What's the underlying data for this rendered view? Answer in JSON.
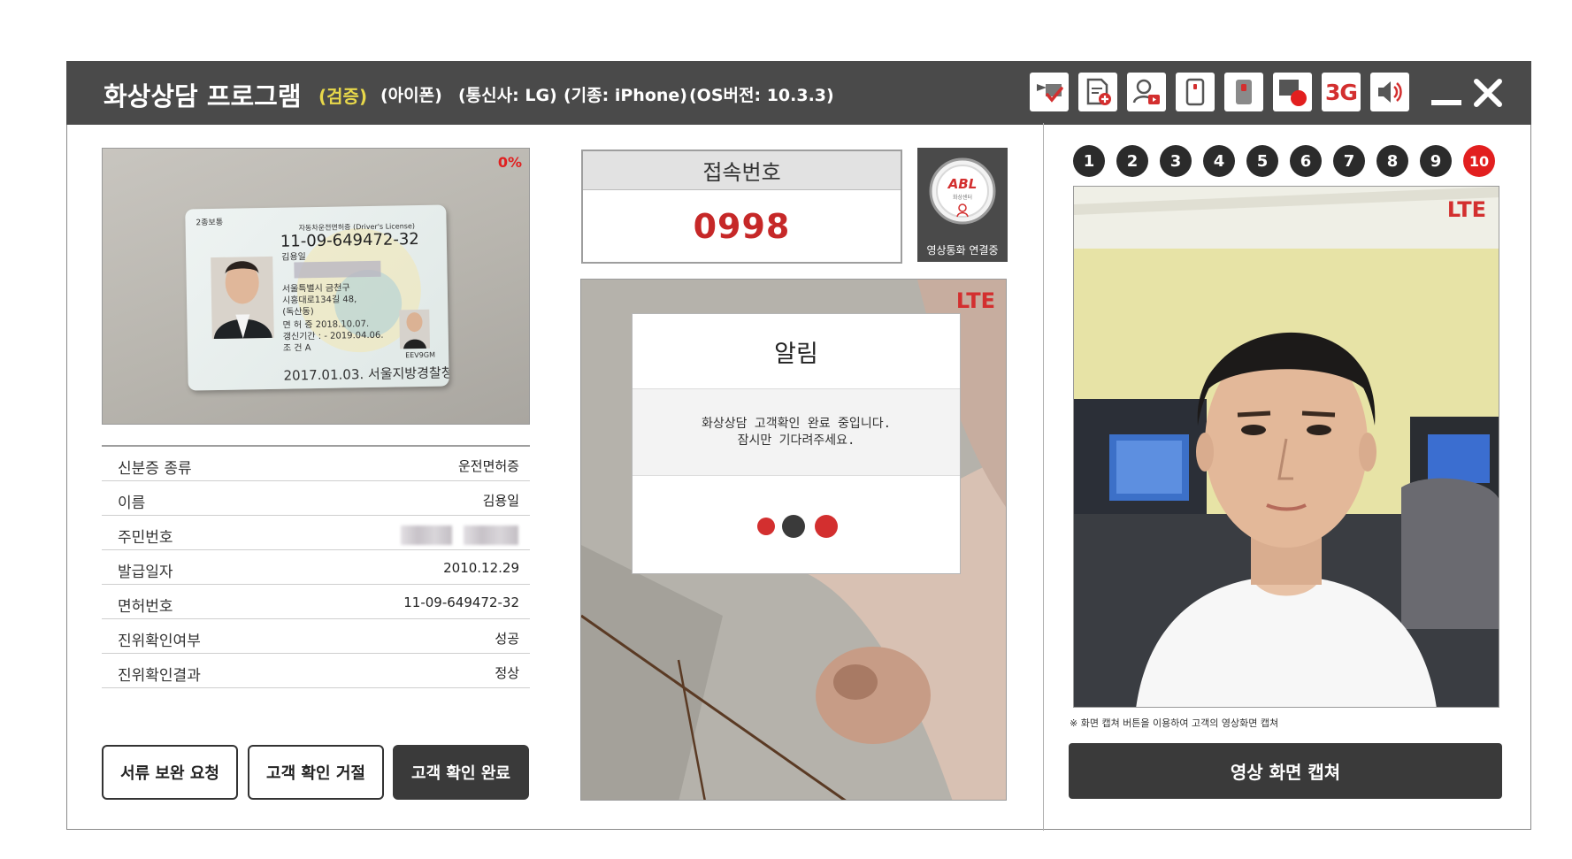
{
  "titlebar": {
    "title": "화상상담 프로그램",
    "verify": "(검증)",
    "device": "(아이폰)",
    "carrier": "(통신사: LG)",
    "model": "(기종: iPhone)",
    "os": "(OS버전: 10.3.3)",
    "toolbar_icons": [
      "verified-screen-icon",
      "add-document-icon",
      "user-video-icon",
      "front-camera-icon",
      "rear-camera-icon",
      "record-icon",
      "3g-icon",
      "speaker-icon"
    ],
    "network_3g_label": "3G"
  },
  "id_capture": {
    "progress_text": "0%",
    "card": {
      "type_label": "2종보통",
      "license_title": "자동차운전면허증 (Driver's License)",
      "license_number": "11-09-649472-32",
      "name": "김용일",
      "address": [
        "서울특별시 금천구",
        "시흥대로134길 48,",
        "(독산동)"
      ],
      "renew_lines": [
        "면 허 증  2018.10.07.",
        "갱신기간 : - 2019.04.06.",
        "조       건 A"
      ],
      "code": "EEV9GM",
      "issue_line": "2017.01.03. 서울지방경찰청장"
    }
  },
  "info_table": {
    "rows": [
      {
        "label": "신분증 종류",
        "value": "운전면허증"
      },
      {
        "label": "이름",
        "value": "김용일"
      },
      {
        "label": "주민번호",
        "value": ""
      },
      {
        "label": "발급일자",
        "value": "2010.12.29"
      },
      {
        "label": "면허번호",
        "value": "11-09-649472-32"
      },
      {
        "label": "진위확인여부",
        "value": "성공"
      },
      {
        "label": "진위확인결과",
        "value": "정상"
      }
    ]
  },
  "actions": {
    "supplement": "서류 보완 요청",
    "reject": "고객 확인 거절",
    "confirm": "고객 확인 완료"
  },
  "connection": {
    "header": "접속번호",
    "number": "0998",
    "abl_logo": "ABL",
    "abl_sub": "화상센터",
    "abl_status": "영상통화 연결중"
  },
  "mid_video": {
    "network": "LTE",
    "modal": {
      "title": "알림",
      "line1": "화상상담 고객확인 완료 중입니다.",
      "line2": "잠시만 기다려주세요."
    }
  },
  "right_panel": {
    "tabs": [
      "1",
      "2",
      "3",
      "4",
      "5",
      "6",
      "7",
      "8",
      "9",
      "10"
    ],
    "active_tab": "10",
    "network": "LTE",
    "capture_note": "※ 화면 캡쳐 버튼을 이용하여 고객의 영상화면 캡쳐",
    "capture_button": "영상 화면 캡쳐"
  },
  "colors": {
    "titlebar_bg": "#4a4a4a",
    "accent_red": "#d32f2f",
    "verify_yellow": "#e8d84a",
    "dark_button": "#3a3a3a"
  }
}
